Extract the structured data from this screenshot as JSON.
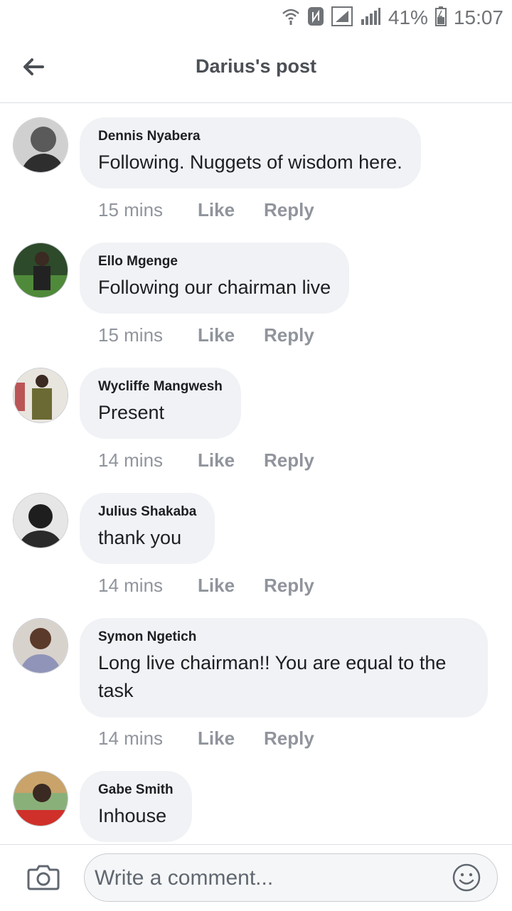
{
  "status_bar": {
    "battery": "41%",
    "time": "15:07",
    "icons": [
      "wifi-icon",
      "nfc-icon",
      "signal-icon",
      "signal-icon",
      "battery-icon"
    ]
  },
  "header": {
    "title": "Darius's post",
    "back_icon": "back-arrow-icon"
  },
  "comments": [
    {
      "name": "Dennis Nyabera",
      "text": "Following. Nuggets of wisdom here.",
      "time": "15 mins",
      "like": "Like",
      "reply": "Reply",
      "avatar_color": "#7a7a7a"
    },
    {
      "name": "Ello Mgenge",
      "text": "Following our chairman live",
      "time": "15 mins",
      "like": "Like",
      "reply": "Reply",
      "avatar_color": "#3e6b3a"
    },
    {
      "name": "Wycliffe Mangwesh",
      "text": "Present",
      "time": "14 mins",
      "like": "Like",
      "reply": "Reply",
      "avatar_color": "#8a8a5a"
    },
    {
      "name": "Julius Shakaba",
      "text": "thank you",
      "time": "14 mins",
      "like": "Like",
      "reply": "Reply",
      "avatar_color": "#333333"
    },
    {
      "name": "Symon Ngetich",
      "text": "Long live chairman!! You are equal to the task",
      "time": "14 mins",
      "like": "Like",
      "reply": "Reply",
      "avatar_color": "#7b5a4a"
    },
    {
      "name": "Gabe Smith",
      "text": "Inhouse",
      "avatar_color": "#6a8a5a"
    }
  ],
  "composer": {
    "placeholder": "Write a comment...",
    "camera_icon": "camera-icon",
    "emoji_icon": "smiley-icon"
  },
  "colors": {
    "bubble": "#f0f2f5",
    "meta": "#90949c",
    "title": "#4b4f56"
  }
}
